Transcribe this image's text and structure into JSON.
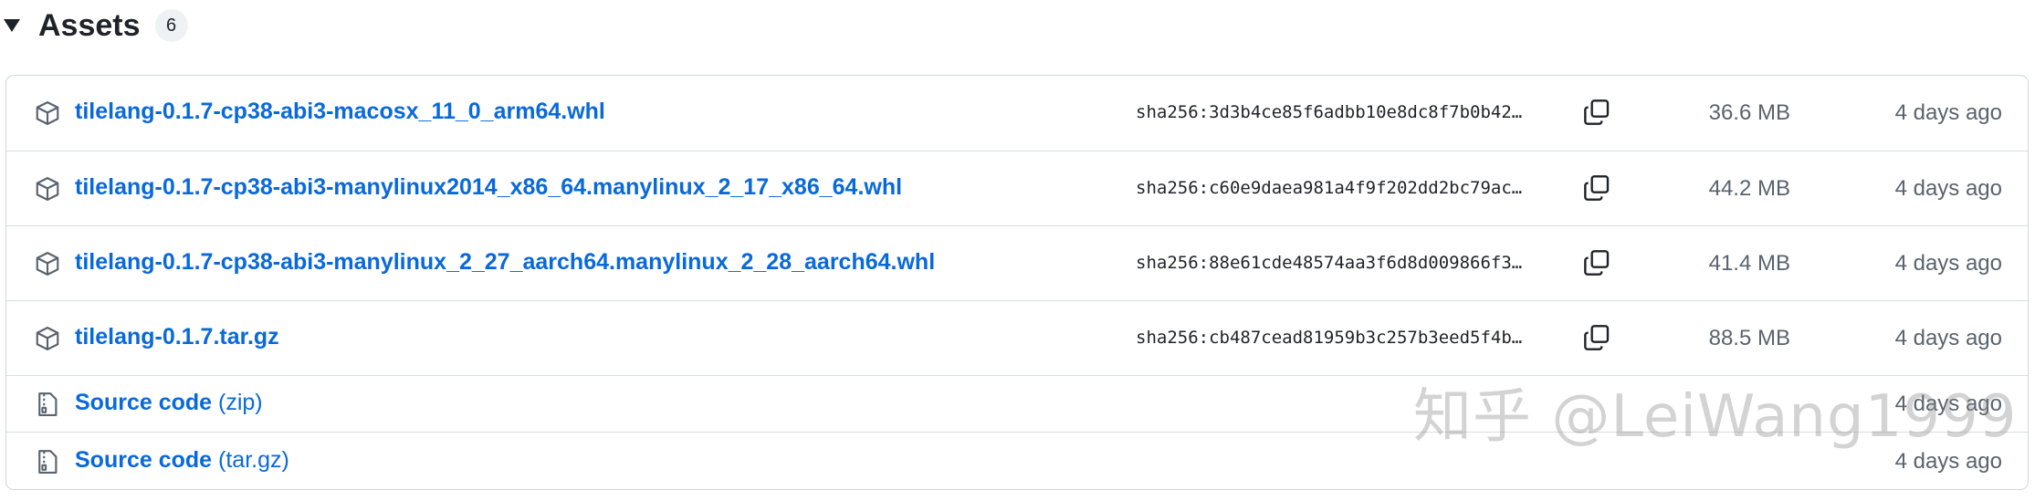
{
  "assets": {
    "title": "Assets",
    "count": "6",
    "items": [
      {
        "name": "tilelang-0.1.7-cp38-abi3-macosx_11_0_arm64.whl",
        "sha": "sha256:3d3b4ce85f6adbb10e8dc8f7b0b42…",
        "size": "36.6 MB",
        "date": "4 days ago",
        "icon": "package-icon"
      },
      {
        "name": "tilelang-0.1.7-cp38-abi3-manylinux2014_x86_64.manylinux_2_17_x86_64.whl",
        "sha": "sha256:c60e9daea981a4f9f202dd2bc79ac…",
        "size": "44.2 MB",
        "date": "4 days ago",
        "icon": "package-icon"
      },
      {
        "name": "tilelang-0.1.7-cp38-abi3-manylinux_2_27_aarch64.manylinux_2_28_aarch64.whl",
        "sha": "sha256:88e61cde48574aa3f6d8d009866f3…",
        "size": "41.4 MB",
        "date": "4 days ago",
        "icon": "package-icon"
      },
      {
        "name": "tilelang-0.1.7.tar.gz",
        "sha": "sha256:cb487cead81959b3c257b3eed5f4b…",
        "size": "88.5 MB",
        "date": "4 days ago",
        "icon": "package-icon"
      },
      {
        "name": "Source code",
        "ext": "(zip)",
        "date": "4 days ago",
        "icon": "file-zip-icon"
      },
      {
        "name": "Source code",
        "ext": "(tar.gz)",
        "date": "4 days ago",
        "icon": "file-zip-icon"
      }
    ]
  },
  "watermark": "知乎 @LeiWang1999",
  "colors": {
    "link": "#0969da",
    "muted": "#59636e",
    "border": "#d0d7de"
  }
}
